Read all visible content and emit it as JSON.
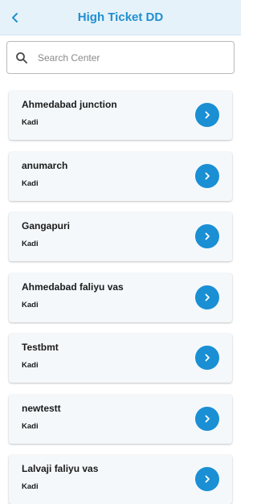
{
  "header": {
    "title": "High Ticket DD",
    "back_icon": "chevron-left-icon"
  },
  "search": {
    "placeholder": "Search Center",
    "value": ""
  },
  "colors": {
    "accent": "#1a8fd4",
    "header_bg": "#e6f2f9",
    "card_bg": "#f4f8fb"
  },
  "centers": [
    {
      "name": "Ahmedabad junction",
      "city": "Kadi"
    },
    {
      "name": "anumarch",
      "city": "Kadi"
    },
    {
      "name": "Gangapuri",
      "city": "Kadi"
    },
    {
      "name": "Ahmedabad faliyu vas",
      "city": "Kadi"
    },
    {
      "name": "Testbmt",
      "city": "Kadi"
    },
    {
      "name": "newtestt",
      "city": "Kadi"
    },
    {
      "name": "Lalvaji faliyu vas",
      "city": "Kadi"
    }
  ]
}
